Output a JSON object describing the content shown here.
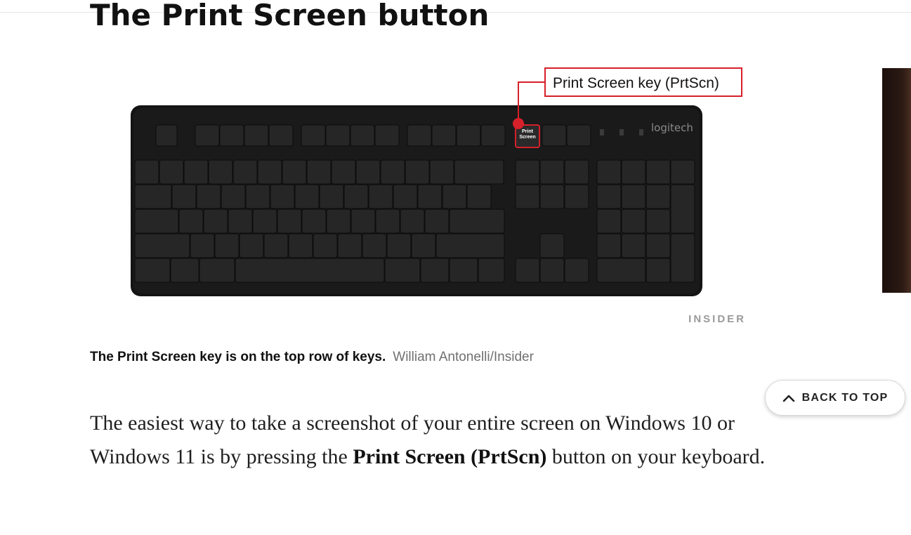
{
  "article": {
    "heading": "The Print Screen button",
    "image": {
      "callout_label": "Print Screen key (PrtScn)",
      "brand_logo": "logitech",
      "watermark": "INSIDER",
      "highlight_color": "#d6202a",
      "print_key_label": [
        "Print",
        "Screen"
      ]
    },
    "caption": {
      "text": "The Print Screen key is on the top row of keys.",
      "credit": "William Antonelli/Insider"
    },
    "body": {
      "before": "The easiest way to take a screenshot of your entire screen on Windows 10 or Windows 11 is by pressing the ",
      "bold": "Print Screen (PrtScn)",
      "after": " button on your keyboard."
    }
  },
  "back_to_top": {
    "label": "BACK TO TOP",
    "icon": "chevron-up-icon"
  }
}
